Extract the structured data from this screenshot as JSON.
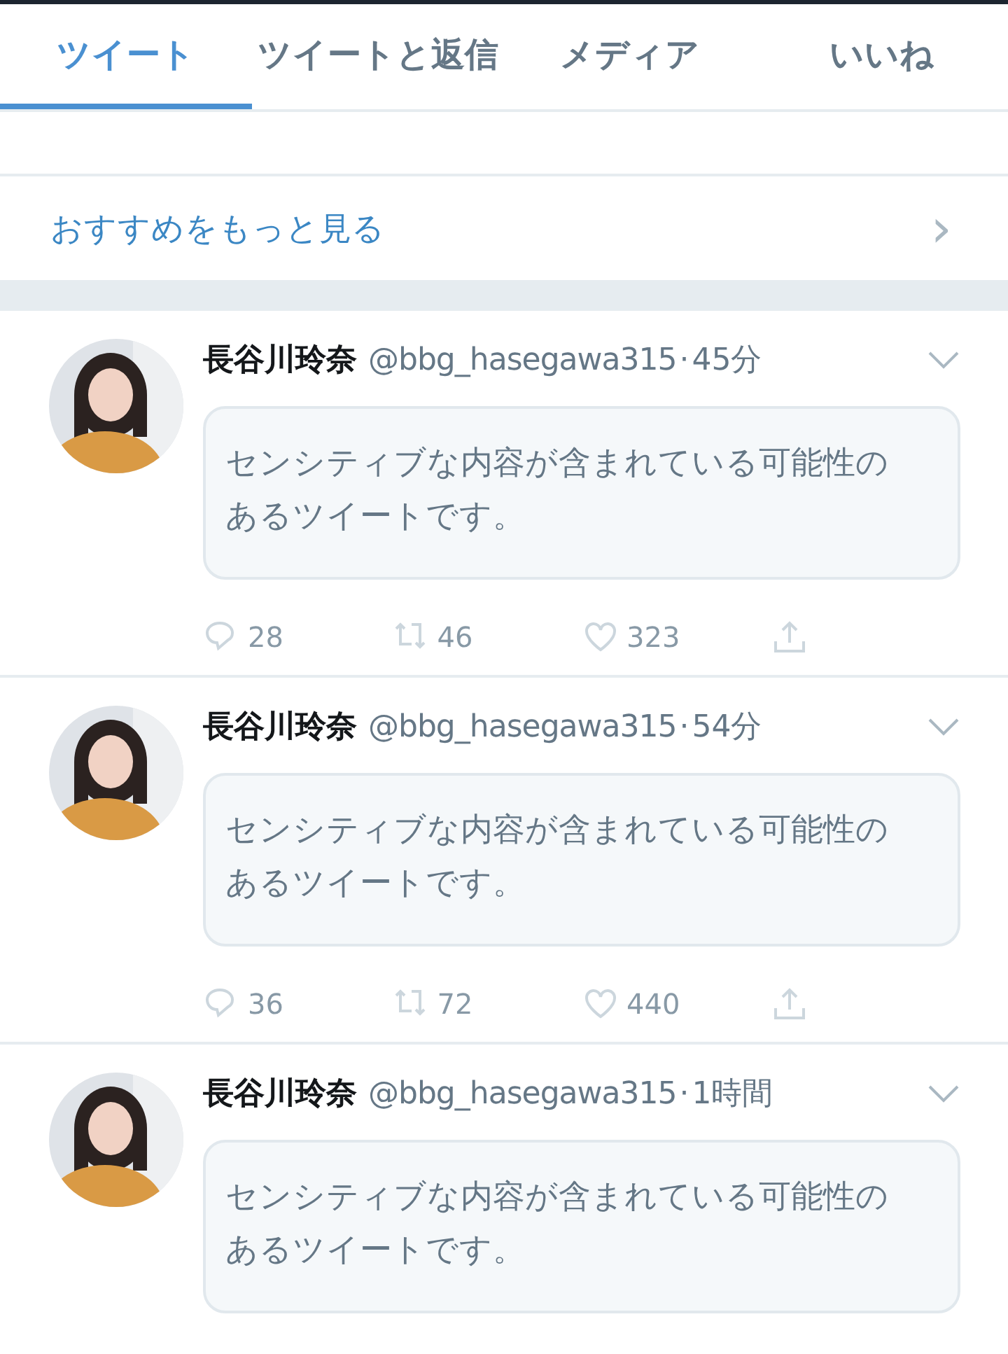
{
  "tabs": [
    {
      "label": "ツイート",
      "selected": true
    },
    {
      "label": "ツイートと返信",
      "selected": false
    },
    {
      "label": "メディア",
      "selected": false
    },
    {
      "label": "いいね",
      "selected": false
    }
  ],
  "see_more": {
    "label": "おすすめをもっと見る",
    "chevron": "›"
  },
  "tweets": [
    {
      "name": "長谷川玲奈",
      "handle": "@bbg_hasegawa315",
      "separator": "·",
      "time": "45分",
      "notice": "センシティブな内容が含まれている可能性のあるツイートです。",
      "actions": {
        "replies": "28",
        "retweets": "46",
        "likes": "323"
      }
    },
    {
      "name": "長谷川玲奈",
      "handle": "@bbg_hasegawa315",
      "separator": "·",
      "time": "54分",
      "notice": "センシティブな内容が含まれている可能性のあるツイートです。",
      "actions": {
        "replies": "36",
        "retweets": "72",
        "likes": "440"
      }
    },
    {
      "name": "長谷川玲奈",
      "handle": "@bbg_hasegawa315",
      "separator": "·",
      "time": "1時間",
      "notice": "センシティブな内容が含まれている可能性のあるツイートです。"
    }
  ]
}
